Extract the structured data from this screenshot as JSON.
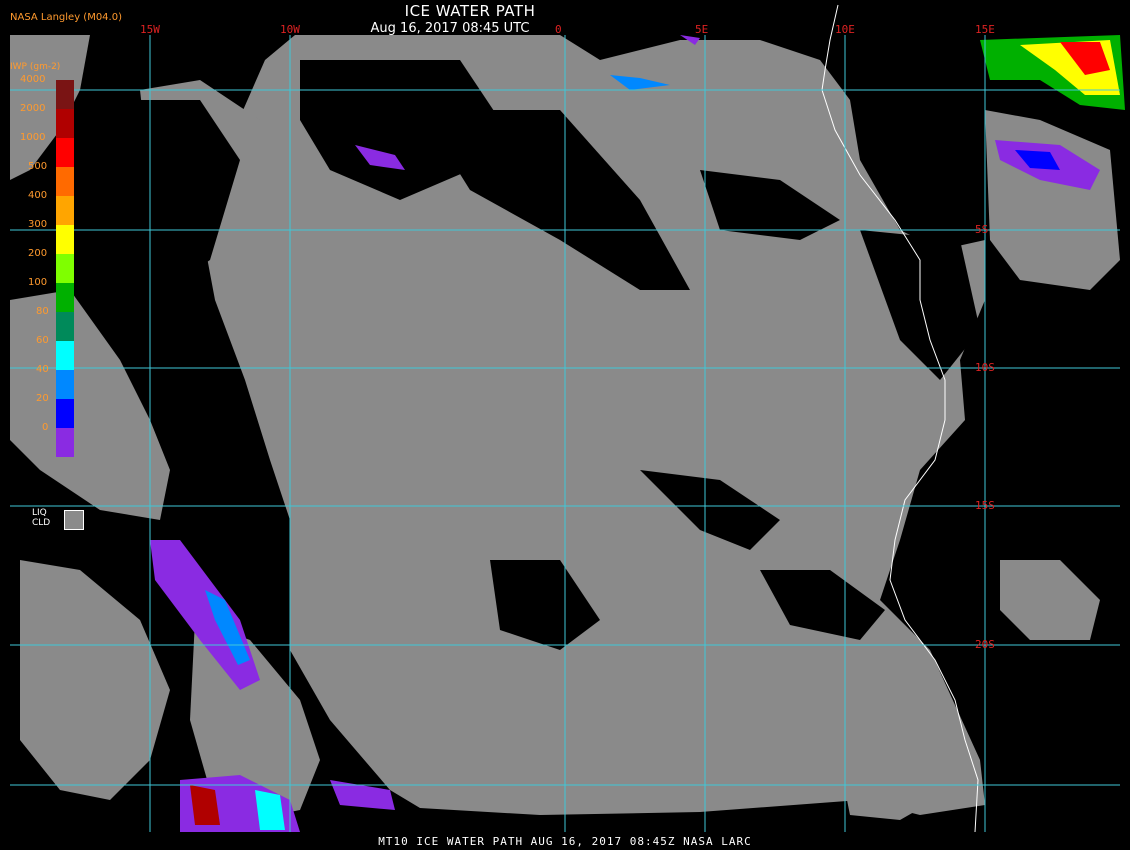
{
  "header": {
    "credit": "NASA Langley (M04.0)",
    "title": "ICE WATER PATH",
    "datetime": "Aug 16, 2017 08:45 UTC"
  },
  "footer": {
    "text": "MT10  ICE WATER PATH   AUG 16, 2017 08:45Z   NASA LARC"
  },
  "grid": {
    "longitudes": [
      "15W",
      "10W",
      "0",
      "5E",
      "10E",
      "15E"
    ],
    "latitudes": [
      "5S",
      "10S",
      "15S",
      "20S"
    ]
  },
  "legend": {
    "unit": "IWP (gm-2)",
    "entries": [
      {
        "label": "4000",
        "color": "#7a1414"
      },
      {
        "label": "2000",
        "color": "#b00000"
      },
      {
        "label": "1000",
        "color": "#ff0000"
      },
      {
        "label": "500",
        "color": "#ff6a00"
      },
      {
        "label": "400",
        "color": "#ffa500"
      },
      {
        "label": "300",
        "color": "#ffff00"
      },
      {
        "label": "200",
        "color": "#7fff00"
      },
      {
        "label": "100",
        "color": "#00b000"
      },
      {
        "label": "80",
        "color": "#008a5a"
      },
      {
        "label": "60",
        "color": "#00ffff"
      },
      {
        "label": "40",
        "color": "#0088ff"
      },
      {
        "label": "20",
        "color": "#0000ff"
      },
      {
        "label": "0",
        "color": "#8a2be2"
      }
    ],
    "liquid_label": "LIQ\nCLD",
    "liquid_color": "#8a8a8a"
  },
  "colors": {
    "grid": "#3fc8d8",
    "coast": "#ffffff",
    "ocean": "#000000",
    "liquid": "#8a8a8a"
  }
}
